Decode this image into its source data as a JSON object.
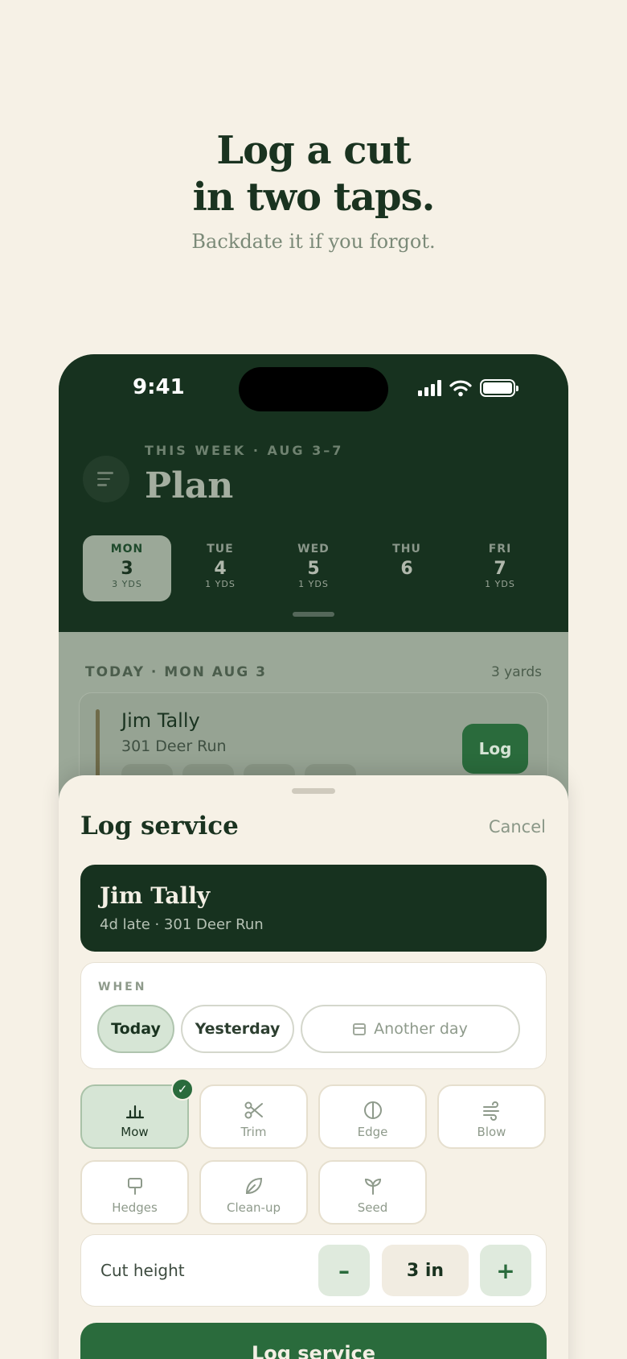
{
  "hero": {
    "title_line1": "Log a cut",
    "title_line2": "in two taps.",
    "subtitle": "Backdate it if you forgot."
  },
  "status_bar": {
    "time": "9:41"
  },
  "header": {
    "week_label": "THIS WEEK · AUG 3–7",
    "title": "Plan"
  },
  "days": [
    {
      "name": "MON",
      "num": "3",
      "yards": "3 YDS",
      "active": true
    },
    {
      "name": "TUE",
      "num": "4",
      "yards": "1 YDS"
    },
    {
      "name": "WED",
      "num": "5",
      "yards": "1 YDS"
    },
    {
      "name": "THU",
      "num": "6",
      "yards": ""
    },
    {
      "name": "FRI",
      "num": "7",
      "yards": "1 YDS"
    }
  ],
  "today": {
    "label": "TODAY · MON AUG 3",
    "count": "3 yards",
    "job": {
      "name": "Jim Tally",
      "address": "301 Deer Run",
      "log_label": "Log"
    }
  },
  "sheet": {
    "title": "Log service",
    "cancel": "Cancel",
    "client": {
      "name": "Jim Tally",
      "subtitle": "4d late · 301 Deer Run"
    },
    "when": {
      "label": "WHEN",
      "today": "Today",
      "yesterday": "Yesterday",
      "another": "Another day"
    },
    "services": [
      {
        "label": "Mow",
        "icon": "mow-icon",
        "selected": true
      },
      {
        "label": "Trim",
        "icon": "scissors-icon"
      },
      {
        "label": "Edge",
        "icon": "edge-icon"
      },
      {
        "label": "Blow",
        "icon": "wind-icon"
      },
      {
        "label": "Hedges",
        "icon": "hedge-icon"
      },
      {
        "label": "Clean-up",
        "icon": "leaf-icon"
      },
      {
        "label": "Seed",
        "icon": "sprout-icon"
      }
    ],
    "cut_height": {
      "label": "Cut height",
      "value": "3 in",
      "minus": "–",
      "plus": "+"
    },
    "submit": "Log service"
  },
  "colors": {
    "forest": "#17321f",
    "accent_green": "#2a6b3c",
    "cream": "#f6f1e6",
    "selected_tint": "#d6e5d5"
  }
}
